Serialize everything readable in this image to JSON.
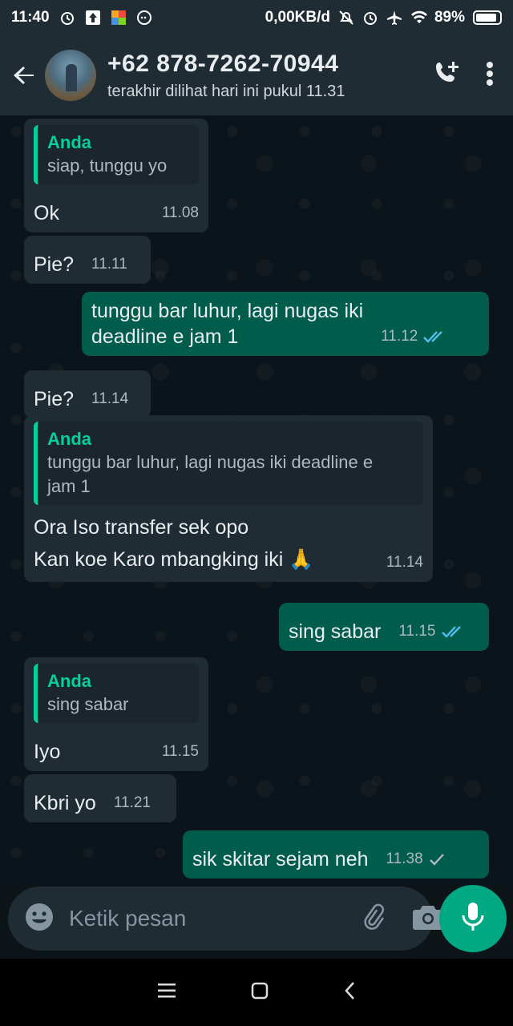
{
  "status_bar": {
    "time": "11:40",
    "network_speed": "0,00KB/d",
    "battery": "89%",
    "battery_level": 0.89,
    "icons": [
      "alarm-icon",
      "upload-icon",
      "app-icon",
      "chat-bubble-icon",
      "mute-icon",
      "alarm-icon",
      "airplane-icon",
      "wifi-icon",
      "battery-icon"
    ]
  },
  "header": {
    "contact_name": "+62 878-7262-70944",
    "last_seen": "terakhir dilihat hari ini pukul 11.31",
    "icons": [
      "back-arrow-icon",
      "add-call-icon",
      "more-vert-icon"
    ]
  },
  "messages": [
    {
      "dir": "in",
      "quote_author": "Anda",
      "quote_text": "siap, tunggu yo",
      "text": "Ok",
      "time": "11.08"
    },
    {
      "dir": "in",
      "text": "Pie?",
      "time": "11.11"
    },
    {
      "dir": "out",
      "text": "tunggu bar luhur, lagi nugas iki\ndeadline e jam 1",
      "time": "11.12",
      "status": "read"
    },
    {
      "dir": "in",
      "text": "Pie?",
      "time": "11.14"
    },
    {
      "dir": "in",
      "quote_author": "Anda",
      "quote_text": "tunggu bar luhur, lagi nugas iki deadline e\njam 1",
      "text": "Ora Iso transfer sek opo\nKan koe Karo mbangking iki 🙏",
      "time": "11.14"
    },
    {
      "dir": "out",
      "text": "sing sabar",
      "time": "11.15",
      "status": "read"
    },
    {
      "dir": "in",
      "quote_author": "Anda",
      "quote_text": "sing sabar",
      "text": "Iyo",
      "time": "11.15"
    },
    {
      "dir": "in",
      "text": "Kbri yo",
      "time": "11.21"
    },
    {
      "dir": "out",
      "text": "sik skitar sejam neh",
      "time": "11.38",
      "status": "sent"
    }
  ],
  "composer": {
    "placeholder": "Ketik pesan",
    "value": "",
    "icons": [
      "emoji-icon",
      "attach-icon",
      "camera-icon",
      "mic-icon"
    ]
  },
  "colors": {
    "header_bg": "#1f2c34",
    "chat_bg": "#0b141a",
    "incoming_bubble": "#1f2c33",
    "outgoing_bubble": "#005c4b",
    "accent": "#00a884",
    "quote_author": "#06cf9c",
    "read_ticks": "#53bdeb"
  }
}
